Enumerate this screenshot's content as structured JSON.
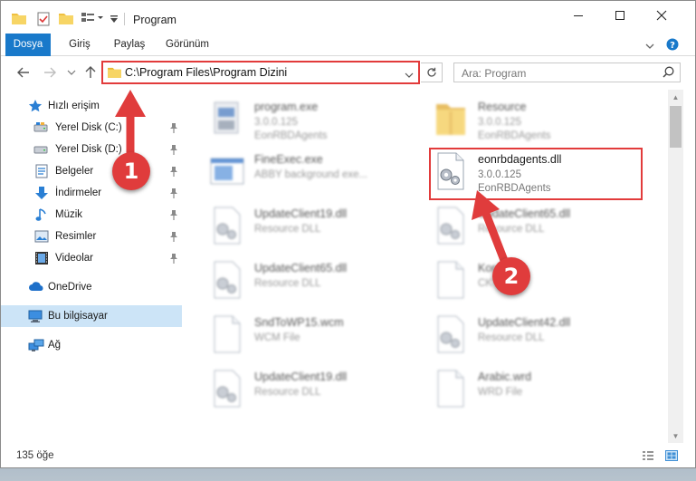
{
  "window": {
    "title": "Program",
    "controls": {
      "minimize": "minimize",
      "maximize": "maximize",
      "close": "close"
    }
  },
  "ribbon": {
    "tabs": [
      {
        "label": "Dosya",
        "active": true
      },
      {
        "label": "Giriş",
        "active": false
      },
      {
        "label": "Paylaş",
        "active": false
      },
      {
        "label": "Görünüm",
        "active": false
      }
    ]
  },
  "address_bar": {
    "path": "C:\\Program Files\\Program Dizini"
  },
  "search": {
    "placeholder": "Ara: Program"
  },
  "nav_pane": {
    "quick_access": "Hızlı erişim",
    "items": [
      {
        "label": "Yerel Disk (C:)",
        "icon": "drive-icon",
        "pinned": true
      },
      {
        "label": "Yerel Disk (D:)",
        "icon": "drive-icon",
        "pinned": true
      },
      {
        "label": "Belgeler",
        "icon": "documents-icon",
        "pinned": true
      },
      {
        "label": "İndirmeler",
        "icon": "download-icon",
        "pinned": true
      },
      {
        "label": "Müzik",
        "icon": "music-icon",
        "pinned": true
      },
      {
        "label": "Resimler",
        "icon": "pictures-icon",
        "pinned": true
      },
      {
        "label": "Videolar",
        "icon": "videos-icon",
        "pinned": true
      }
    ],
    "onedrive": "OneDrive",
    "this_pc": "Bu bilgisayar",
    "network": "Ağ"
  },
  "files": [
    {
      "name": "program.exe",
      "line2": "3.0.0.125",
      "line3": "EonRBDAgents",
      "icon": "exe-icon",
      "blurred": true
    },
    {
      "name": "Resource",
      "line2": "3.0.0.125",
      "line3": "EonRBDAgents",
      "icon": "folder-icon",
      "blurred": true
    },
    {
      "name": "FineExec.exe",
      "line2": "ABBY background exe...",
      "line3": "",
      "icon": "app-window-icon",
      "blurred": true
    },
    {
      "name": "eonrbdagents.dll",
      "line2": "3.0.0.125",
      "line3": "EonRBDAgents",
      "icon": "dll-gear-icon",
      "blurred": false
    },
    {
      "name": "UpdateClient19.dll",
      "line2": "Resource DLL",
      "line3": "",
      "icon": "dll-gear-icon",
      "blurred": true
    },
    {
      "name": "UpdateClient65.dll",
      "line2": "Resource DLL",
      "line3": "",
      "icon": "dll-gear-icon",
      "blurred": true
    },
    {
      "name": "UpdateClient65.dll",
      "line2": "Resource DLL",
      "line3": "",
      "icon": "dll-gear-icon",
      "blurred": true
    },
    {
      "name": "Kor",
      "line2": "CK",
      "line3": "",
      "icon": "blank-file-icon",
      "blurred": true
    },
    {
      "name": "SndToWP15.wcm",
      "line2": "WCM File",
      "line3": "",
      "icon": "blank-file-icon",
      "blurred": true
    },
    {
      "name": "UpdateClient42.dll",
      "line2": "Resource DLL",
      "line3": "",
      "icon": "dll-gear-icon",
      "blurred": true
    },
    {
      "name": "UpdateClient19.dll",
      "line2": "Resource DLL",
      "line3": "",
      "icon": "dll-gear-icon",
      "blurred": true
    },
    {
      "name": "Arabic.wrd",
      "line2": "WRD File",
      "line3": "",
      "icon": "blank-file-icon",
      "blurred": true
    }
  ],
  "status": {
    "count": "135 öğe"
  },
  "annotations": {
    "step1": "1",
    "step2": "2",
    "color": "#e03c3c"
  },
  "colors": {
    "accent": "#1979ca",
    "selection": "#cce4f7",
    "highlight": "#e23b3b"
  }
}
